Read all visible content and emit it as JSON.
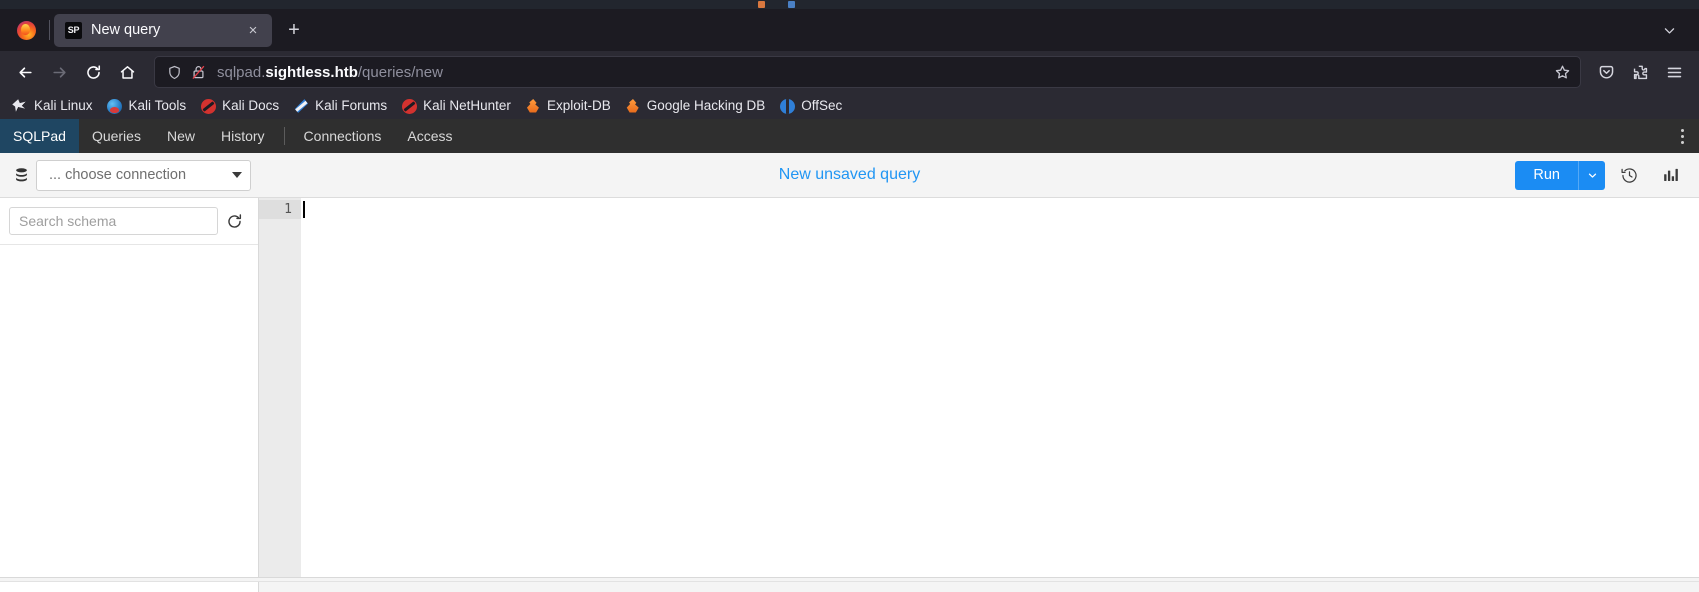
{
  "browser": {
    "tab": {
      "favicon_text": "SP",
      "title": "New query",
      "close_label": "×"
    },
    "new_tab_label": "+",
    "tab_list_chevron": "chevron-down",
    "nav": {
      "back": "back-arrow",
      "forward": "forward-arrow",
      "reload": "reload",
      "home": "home"
    },
    "url": {
      "prefix": "sqlpad.",
      "host_bold": "sightless.htb",
      "path": "/queries/new",
      "full": "sqlpad.sightless.htb/queries/new",
      "security": "insecure-http"
    },
    "bookmarks": [
      {
        "label": "Kali Linux",
        "icon": "kali-dragon-icon"
      },
      {
        "label": "Kali Tools",
        "icon": "kali-tools-icon"
      },
      {
        "label": "Kali Docs",
        "icon": "kali-docs-icon"
      },
      {
        "label": "Kali Forums",
        "icon": "kali-forums-icon"
      },
      {
        "label": "Kali NetHunter",
        "icon": "kali-nethunter-icon"
      },
      {
        "label": "Exploit-DB",
        "icon": "exploit-db-icon"
      },
      {
        "label": "Google Hacking DB",
        "icon": "google-hacking-db-icon"
      },
      {
        "label": "OffSec",
        "icon": "offsec-icon"
      }
    ]
  },
  "app": {
    "brand": "SQLPad",
    "nav_items": [
      {
        "label": "Queries"
      },
      {
        "label": "New"
      },
      {
        "label": "History"
      }
    ],
    "nav_items_right": [
      {
        "label": "Connections"
      },
      {
        "label": "Access"
      }
    ],
    "overflow_menu": "kebab-menu",
    "toolbar": {
      "connection_placeholder": "... choose connection",
      "query_title": "New unsaved query",
      "run_label": "Run",
      "run_dropdown": "chevron-down",
      "history_icon": "clock-history-icon",
      "chart_icon": "bar-chart-icon"
    },
    "schema": {
      "search_placeholder": "Search schema",
      "refresh_icon": "refresh-icon"
    },
    "editor": {
      "line_numbers": [
        "1"
      ],
      "content": ""
    }
  }
}
